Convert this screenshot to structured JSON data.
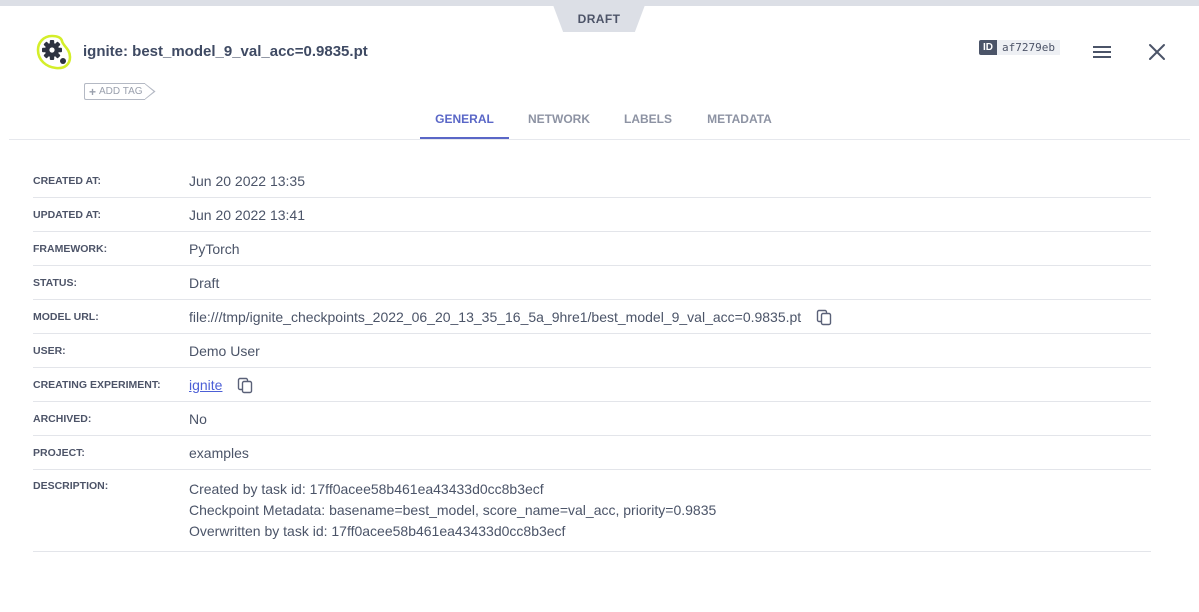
{
  "status_tab": "DRAFT",
  "model": {
    "title": "ignite: best_model_9_val_acc=0.9835.pt",
    "add_tag_label": "ADD TAG",
    "id_label": "ID",
    "id_value": "af7279eb"
  },
  "icons": {
    "logo": "gear-logo-icon",
    "menu": "hamburger-menu-icon",
    "close": "close-icon",
    "copy": "copy-icon"
  },
  "colors": {
    "accent": "#5a67c7",
    "logo_ring": "#d4ee2a",
    "link": "#4c5fd6"
  },
  "tabs": [
    {
      "label": "GENERAL",
      "active": true
    },
    {
      "label": "NETWORK",
      "active": false
    },
    {
      "label": "LABELS",
      "active": false
    },
    {
      "label": "METADATA",
      "active": false
    }
  ],
  "details": {
    "created_at": {
      "label": "CREATED AT:",
      "value": "Jun 20 2022 13:35"
    },
    "updated_at": {
      "label": "UPDATED AT:",
      "value": "Jun 20 2022 13:41"
    },
    "framework": {
      "label": "FRAMEWORK:",
      "value": "PyTorch"
    },
    "status": {
      "label": "STATUS:",
      "value": "Draft"
    },
    "model_url": {
      "label": "MODEL URL:",
      "value": "file:///tmp/ignite_checkpoints_2022_06_20_13_35_16_5a_9hre1/best_model_9_val_acc=0.9835.pt"
    },
    "user": {
      "label": "USER:",
      "value": "Demo User"
    },
    "creating_experiment": {
      "label": "CREATING EXPERIMENT:",
      "value": "ignite"
    },
    "archived": {
      "label": "ARCHIVED:",
      "value": "No"
    },
    "project": {
      "label": "PROJECT:",
      "value": "examples"
    },
    "description": {
      "label": "DESCRIPTION:",
      "lines": [
        "Created by task id: 17ff0acee58b461ea43433d0cc8b3ecf",
        "Checkpoint Metadata: basename=best_model, score_name=val_acc, priority=0.9835",
        "Overwritten by task id: 17ff0acee58b461ea43433d0cc8b3ecf"
      ]
    }
  }
}
